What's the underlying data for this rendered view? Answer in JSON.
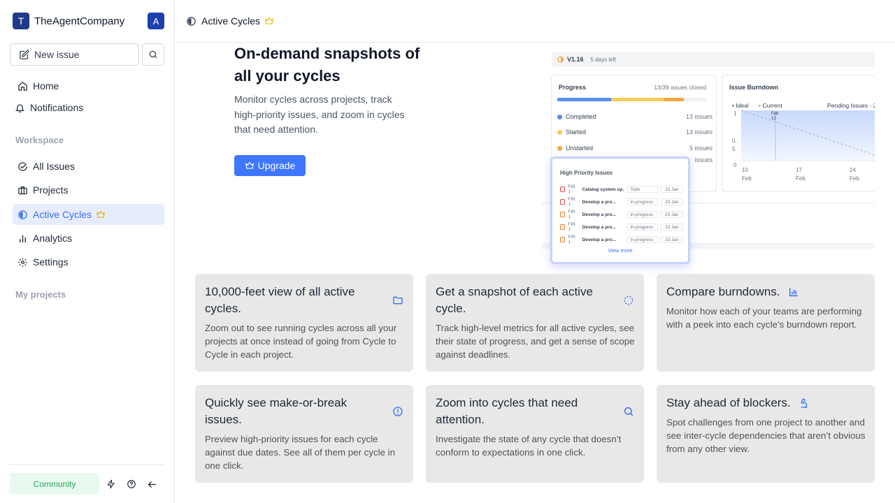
{
  "workspace": {
    "initial": "T",
    "name": "TheAgentCompany",
    "avatar": "A"
  },
  "sidebar": {
    "new_issue": "New issue",
    "top_items": [
      {
        "label": "Home"
      },
      {
        "label": "Notifications"
      }
    ],
    "workspace_label": "Workspace",
    "workspace_items": [
      {
        "label": "All Issues"
      },
      {
        "label": "Projects"
      },
      {
        "label": "Active Cycles"
      },
      {
        "label": "Analytics"
      },
      {
        "label": "Settings"
      }
    ],
    "projects_label": "My projects",
    "community": "Community"
  },
  "header": {
    "title": "Active Cycles"
  },
  "hero": {
    "title": "On-demand snapshots of all your cycles",
    "description": "Monitor cycles across projects, track high-priority issues, and zoom in cycles that need attention.",
    "upgrade": "Upgrade"
  },
  "preview": {
    "version": "V1.16",
    "days_left": "5 days left",
    "progress_title": "Progress",
    "progress_closed": "13/39 issues closed",
    "rows": [
      {
        "label": "Completed",
        "count": "13 issues",
        "color": "#5b8def"
      },
      {
        "label": "Started",
        "count": "13 issues",
        "color": "#f5cd5b"
      },
      {
        "label": "Unstarted",
        "count": "5 issues",
        "color": "#f5a742"
      },
      {
        "label": "",
        "count": "issues",
        "color": "#d1d5db"
      }
    ],
    "burndown_title": "Issue Burndown",
    "legend_ideal": "Ideal",
    "legend_current": "Current",
    "legend_pending": "Pending Issues - 2",
    "y_ticks": [
      "1",
      "0.5",
      "0"
    ],
    "x_ticks": [
      {
        "d": "10",
        "m": "Feb"
      },
      {
        "d": "17",
        "m": "Feb"
      },
      {
        "d": "24",
        "m": "Feb"
      }
    ],
    "tooltip": "Feb 12",
    "high_priority_title": "High Priority Issues",
    "hp_issues": [
      {
        "id": "FIR 1",
        "name": "Catalog system up...",
        "state": "Todo",
        "date": "23 Jan",
        "pcolor": "#ef4444"
      },
      {
        "id": "FIR 1",
        "name": "Develop a pro...",
        "state": "In-progress",
        "date": "23 Jan",
        "pcolor": "#ef4444"
      },
      {
        "id": "FIR 1",
        "name": "Develop a pro...",
        "state": "In-progress",
        "date": "23 Jan",
        "pcolor": "#f97316"
      },
      {
        "id": "FIR 1",
        "name": "Develop a pro...",
        "state": "In-progress",
        "date": "23 Jan",
        "pcolor": "#f97316"
      },
      {
        "id": "FIR 1",
        "name": "Develop a pro...",
        "state": "In-progress",
        "date": "23 Jan",
        "pcolor": "#f97316"
      }
    ],
    "view_more": "View more"
  },
  "features": [
    {
      "title": "10,000-feet view of all active cycles.",
      "desc": "Zoom out to see running cycles across all your projects at once instead of going from Cycle to Cycle in each project.",
      "icon": "folder-icon"
    },
    {
      "title": "Get a snapshot of each active cycle.",
      "desc": "Track high-level metrics for all active cycles, see their state of progress, and get a sense of scope against deadlines.",
      "icon": "cycle-icon"
    },
    {
      "title": "Compare burndowns.",
      "desc": "Monitor how each of your teams are performing with a peek into each cycle’s burndown report.",
      "icon": "bar-chart-icon"
    },
    {
      "title": "Quickly see make-or-break issues.",
      "desc": "Preview high-priority issues for each cycle against due dates. See all of them per cycle in one click.",
      "icon": "alert-circle-icon"
    },
    {
      "title": "Zoom into cycles that need attention.",
      "desc": "Investigate the state of any cycle that doesn’t conform to expectations in one click.",
      "icon": "search-icon"
    },
    {
      "title": "Stay ahead of blockers.",
      "desc": "Spot challenges from one project to another and see inter-cycle dependencies that aren’t obvious from any other view.",
      "icon": "microscope-icon"
    }
  ]
}
